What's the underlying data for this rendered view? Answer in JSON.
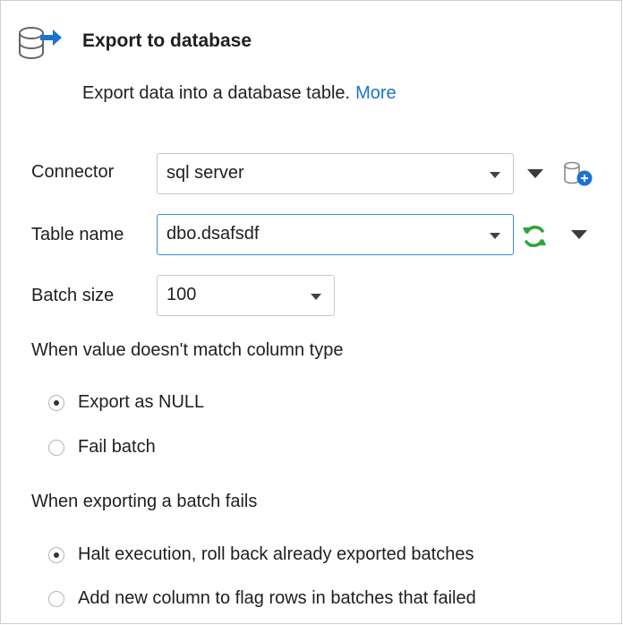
{
  "header": {
    "title": "Export to database",
    "description": "Export data into a database table.",
    "more_link": "More",
    "icon": "database-export-icon"
  },
  "connector": {
    "label": "Connector",
    "value": "sql server",
    "add_icon": "add-connector-icon"
  },
  "table": {
    "label": "Table name",
    "value": "dbo.dsafsdf",
    "refresh_icon": "refresh-icon",
    "refresh_color": "#2ea43a"
  },
  "batch": {
    "label": "Batch size",
    "value": "100"
  },
  "mismatch": {
    "title": "When value doesn't match column type",
    "options": [
      {
        "label": "Export as NULL",
        "checked": true
      },
      {
        "label": "Fail batch",
        "checked": false
      }
    ]
  },
  "failure": {
    "title": "When exporting a batch fails",
    "options": [
      {
        "label": "Halt execution, roll back already exported batches",
        "checked": true
      },
      {
        "label": "Add new column to flag rows in batches that failed",
        "checked": false
      }
    ]
  },
  "colors": {
    "accent": "#1a73d0",
    "focus_border": "#3b8fd9"
  }
}
